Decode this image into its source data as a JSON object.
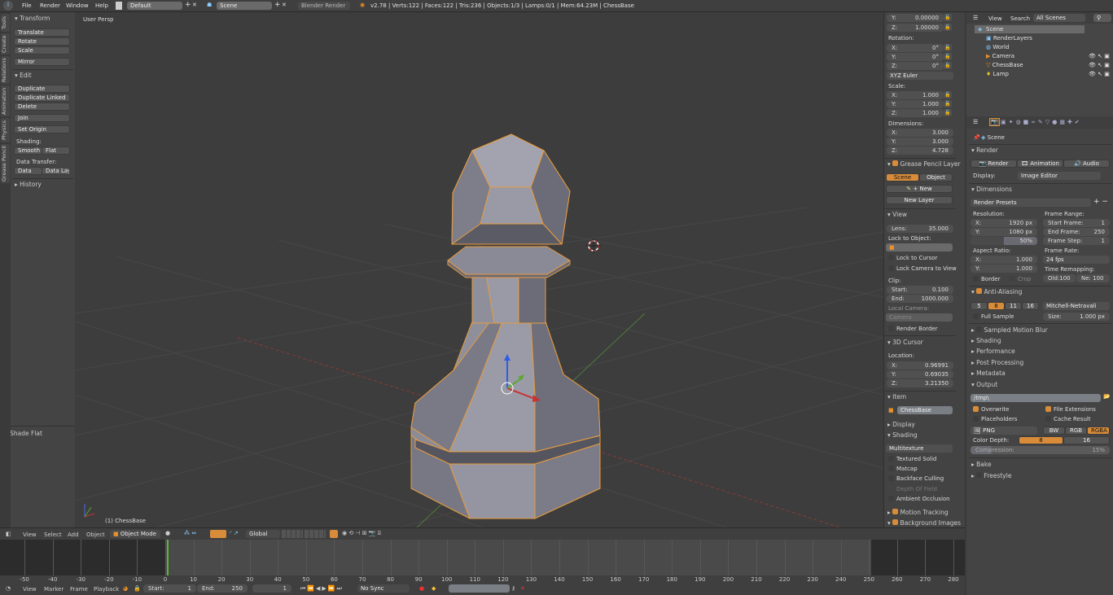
{
  "topbar": {
    "menus": [
      "File",
      "Render",
      "Window",
      "Help"
    ],
    "screen_layout": "Default",
    "scene": "Scene",
    "engine": "Blender Render",
    "stats": "v2.78 | Verts:122 | Faces:122 | Tris:236 | Objects:1/3 | Lamps:0/1 | Mem:64.23M | ChessBase"
  },
  "toolshelf": {
    "tabs": [
      "Tools",
      "Create",
      "Relations",
      "Animation",
      "Physics",
      "Grease Pencil"
    ],
    "transform_header": "Transform",
    "translate": "Translate",
    "rotate": "Rotate",
    "scale": "Scale",
    "mirror": "Mirror",
    "edit_header": "Edit",
    "duplicate": "Duplicate",
    "duplicate_linked": "Duplicate Linked",
    "delete": "Delete",
    "join": "Join",
    "set_origin": "Set Origin",
    "shading_label": "Shading:",
    "smooth": "Smooth",
    "flat": "Flat",
    "data_transfer_label": "Data Transfer:",
    "data": "Data",
    "data_layout": "Data Layo",
    "history_header": "History",
    "operator_header": "Shade Flat"
  },
  "viewport": {
    "view_name": "User Persp",
    "object_label": "(1) ChessBase"
  },
  "npanel": {
    "loc_y": "0.00000",
    "loc_z": "1.00000",
    "rotation_label": "Rotation:",
    "rot_x": "0°",
    "rot_y": "0°",
    "rot_z": "0°",
    "rotation_mode": "XYZ Euler",
    "scale_label": "Scale:",
    "scale_x": "1.000",
    "scale_y": "1.000",
    "scale_z": "1.000",
    "dimensions_label": "Dimensions:",
    "dim_x": "3.000",
    "dim_y": "3.000",
    "dim_z": "4.728",
    "gp_header": "Grease Pencil Layer",
    "scene_btn": "Scene",
    "object_btn": "Object",
    "new_btn": "New",
    "new_layer_btn": "New Layer",
    "view_header": "View",
    "lens_label": "Lens:",
    "lens": "35.000",
    "lock_object_label": "Lock to Object:",
    "lock_cursor": "Lock to Cursor",
    "lock_camera": "Lock Camera to View",
    "clip_label": "Clip:",
    "clip_start_label": "Start:",
    "clip_start": "0.100",
    "clip_end_label": "End:",
    "clip_end": "1000.000",
    "local_camera_label": "Local Camera:",
    "local_camera": "Camera",
    "render_border": "Render Border",
    "cursor_header": "3D Cursor",
    "location_label": "Location:",
    "cur_x": "0.96991",
    "cur_y": "0.69035",
    "cur_z": "3.21350",
    "item_header": "Item",
    "item_name": "ChessBase",
    "display_header": "Display",
    "shading_header": "Shading",
    "shading_mode": "Multitexture",
    "textured_solid": "Textured Solid",
    "matcap": "Matcap",
    "backface": "Backface Culling",
    "dof": "Depth Of Field",
    "ao": "Ambient Occlusion",
    "motion_tracking": "Motion Tracking",
    "bg_images": "Background Images",
    "x": "X:",
    "y": "Y:",
    "z": "Z:"
  },
  "outliner": {
    "view": "View",
    "search": "Search",
    "filter": "All Scenes",
    "items": [
      "Scene",
      "RenderLayers",
      "World",
      "Camera",
      "ChessBase",
      "Lamp"
    ]
  },
  "props": {
    "context": "Scene",
    "render_header": "Render",
    "render_btn": "Render",
    "animation_btn": "Animation",
    "audio_btn": "Audio",
    "display_label": "Display:",
    "display_value": "Image Editor",
    "dimensions_header": "Dimensions",
    "presets": "Render Presets",
    "resolution_label": "Resolution:",
    "res_x": "1920 px",
    "res_y": "1080 px",
    "res_pct": "50%",
    "frame_range_label": "Frame Range:",
    "start_label": "Start Frame:",
    "start": "1",
    "end_label": "End Frame:",
    "end": "250",
    "step_label": "Frame Step:",
    "step": "1",
    "aspect_label": "Aspect Ratio:",
    "asp_x": "1.000",
    "asp_y": "1.000",
    "frame_rate_label": "Frame Rate:",
    "fps": "24 fps",
    "remap_label": "Time Remapping:",
    "old": "Old:100",
    "new": "Ne: 100",
    "border": "Border",
    "crop": "Crop",
    "aa_header": "Anti-Aliasing",
    "aa_samples": [
      "5",
      "8",
      "11",
      "16"
    ],
    "aa_filter": "Mitchell-Netravali",
    "full_sample": "Full Sample",
    "size_label": "Size:",
    "size": "1.000 px",
    "collapsed": [
      "Sampled Motion Blur",
      "Shading",
      "Performance",
      "Post Processing",
      "Metadata"
    ],
    "output_header": "Output",
    "path": "/tmp\\",
    "overwrite": "Overwrite",
    "file_ext": "File Extensions",
    "placeholders": "Placeholders",
    "cache": "Cache Result",
    "format": "PNG",
    "bw": "BW",
    "rgb": "RGB",
    "rgba": "RGBA",
    "color_depth_label": "Color Depth:",
    "depth8": "8",
    "depth16": "16",
    "compression_label": "Compression:",
    "compression": "15%",
    "bake": "Bake",
    "freestyle": "Freestyle",
    "x": "X:",
    "y": "Y:"
  },
  "view_header": {
    "menus": [
      "View",
      "Select",
      "Add",
      "Object"
    ],
    "mode": "Object Mode",
    "orientation": "Global"
  },
  "timeline": {
    "ticks": [
      -50,
      -40,
      -30,
      -20,
      -10,
      0,
      10,
      20,
      30,
      40,
      50,
      60,
      70,
      80,
      90,
      100,
      110,
      120,
      130,
      140,
      150,
      160,
      170,
      180,
      190,
      200,
      210,
      220,
      230,
      240,
      250,
      260,
      270,
      280
    ],
    "current_frame": 1,
    "start": 1,
    "end": 250
  },
  "timeline_header": {
    "menus": [
      "View",
      "Marker",
      "Frame",
      "Playback"
    ],
    "start_label": "Start:",
    "start": "1",
    "end_label": "End:",
    "end": "250",
    "current": "1",
    "sync": "No Sync"
  },
  "colors": {
    "accent": "#d88c3a",
    "selection": "#e89b3d",
    "x_axis": "#c83232",
    "y_axis": "#5aa832",
    "z_axis": "#2e5ce6"
  }
}
